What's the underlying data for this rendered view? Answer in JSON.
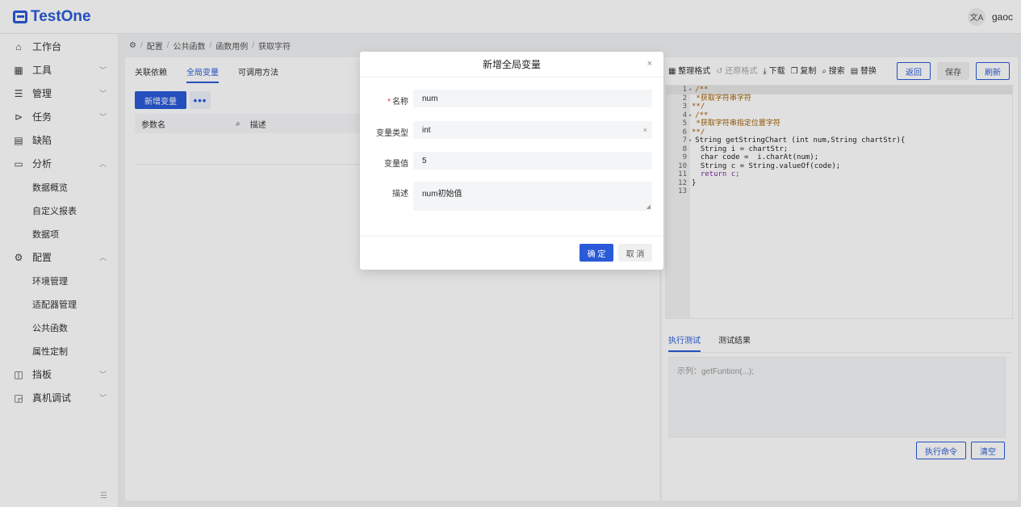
{
  "header": {
    "logo_text": "TestOne",
    "translate_icon": "文A",
    "username": "gaoc"
  },
  "sidebar": {
    "items": [
      {
        "label": "工作台",
        "icon": "home-icon",
        "glyph": "⌂",
        "chevron": ""
      },
      {
        "label": "工具",
        "icon": "grid-icon",
        "glyph": "▦",
        "chevron": "﹀"
      },
      {
        "label": "管理",
        "icon": "list-icon",
        "glyph": "☰",
        "chevron": "﹀"
      },
      {
        "label": "任务",
        "icon": "task-icon",
        "glyph": "⊳",
        "chevron": "﹀"
      },
      {
        "label": "缺陷",
        "icon": "bug-icon",
        "glyph": "▤",
        "chevron": ""
      },
      {
        "label": "分析",
        "icon": "chart-icon",
        "glyph": "▭",
        "chevron": "︿"
      }
    ],
    "analysis_sub": [
      "数据概览",
      "自定义报表",
      "数据项"
    ],
    "config": {
      "label": "配置",
      "glyph": "⚙",
      "chevron": "︿"
    },
    "config_sub": [
      "环境管理",
      "适配器管理",
      "公共函数",
      "属性定制"
    ],
    "bottom_items": [
      {
        "label": "挡板",
        "glyph": "◫",
        "chevron": "﹀"
      },
      {
        "label": "真机调试",
        "glyph": "◲",
        "chevron": "﹀"
      }
    ],
    "collapse_glyph": "☰"
  },
  "breadcrumb": {
    "home_glyph": "⚙",
    "items": [
      "配置",
      "公共函数",
      "函数用例",
      "获取字符"
    ],
    "sep": "/"
  },
  "left_panel": {
    "tabs": [
      "关联依赖",
      "全局变量",
      "可调用方法"
    ],
    "active_tab": 1,
    "add_button": "新增变量",
    "more_button": "•••",
    "table": {
      "col1": "参数名",
      "col2_icon": "⌕",
      "col2": "描述"
    }
  },
  "editor": {
    "toolbar": [
      {
        "glyph": "▦",
        "label": "整理格式",
        "disabled": false
      },
      {
        "glyph": "↺",
        "label": "还原格式",
        "disabled": true
      },
      {
        "glyph": "⤓",
        "label": "下载",
        "disabled": false
      },
      {
        "glyph": "❐",
        "label": "复制",
        "disabled": false
      },
      {
        "glyph": "⌕",
        "label": "搜索",
        "disabled": false
      },
      {
        "glyph": "▤",
        "label": "替换",
        "disabled": false
      }
    ],
    "back_button": "返回",
    "save_button": "保存",
    "refresh_button": "刷新",
    "lines": [
      {
        "n": "1",
        "fold": "▾",
        "text": "/**",
        "cls": "cm-comment"
      },
      {
        "n": "2",
        "fold": "",
        "text": " *获取字符串字符",
        "cls": "cm-comment"
      },
      {
        "n": "3",
        "fold": "",
        "text": "**/",
        "cls": "cm-comment"
      },
      {
        "n": "4",
        "fold": "▾",
        "text": "/**",
        "cls": "cm-comment"
      },
      {
        "n": "5",
        "fold": "",
        "text": " *获取字符串指定位置字符",
        "cls": "cm-comment"
      },
      {
        "n": "6",
        "fold": "",
        "text": "**/",
        "cls": "cm-comment"
      },
      {
        "n": "7",
        "fold": "▾",
        "text": "String getStringChart (int num,String chartStr){",
        "cls": "cm-plain"
      },
      {
        "n": "8",
        "fold": "",
        "text": "  String i = chartStr;",
        "cls": "cm-plain"
      },
      {
        "n": "9",
        "fold": "",
        "text": "  char code =  i.charAt(num);",
        "cls": "cm-plain"
      },
      {
        "n": "10",
        "fold": "",
        "text": "  String c = String.valueOf(code);",
        "cls": "cm-plain"
      },
      {
        "n": "11",
        "fold": "",
        "text": "  return c;",
        "cls": "cm-kw"
      },
      {
        "n": "12",
        "fold": "",
        "text": "}",
        "cls": "cm-plain"
      },
      {
        "n": "13",
        "fold": "",
        "text": "",
        "cls": "cm-plain"
      }
    ],
    "bottom_tabs": [
      "执行测试",
      "测试结果"
    ],
    "exec_placeholder": "示列：getFuntion(...);",
    "exec_button": "执行命令",
    "clear_button": "清空"
  },
  "modal": {
    "title": "新增全局变量",
    "close_glyph": "×",
    "fields": {
      "name_label": "名称",
      "name_required": "*",
      "name_value": "num",
      "type_label": "变量类型",
      "type_value": "int",
      "type_clear": "×",
      "value_label": "变量值",
      "value_value": "5",
      "desc_label": "描述",
      "desc_value": "num初始值",
      "resize_glyph": "◢"
    },
    "confirm_button": "确 定",
    "cancel_button": "取 消"
  },
  "colors": {
    "primary": "#2a5ad8",
    "comment": "#a35f00",
    "required": "#e03030"
  }
}
